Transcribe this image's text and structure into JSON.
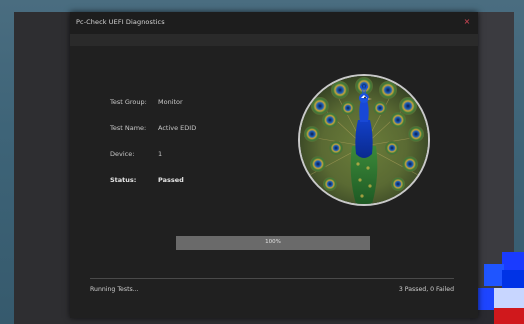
{
  "window": {
    "title": "Pc-Check UEFI Diagnostics",
    "close_glyph": "×"
  },
  "test_info": [
    {
      "label": "Test Group:",
      "value": "Monitor",
      "bold": false
    },
    {
      "label": "Test Name:",
      "value": "Active EDID",
      "bold": false
    },
    {
      "label": "Device:",
      "value": "1",
      "bold": false
    },
    {
      "label": "Status:",
      "value": "Passed",
      "bold": true
    }
  ],
  "image": {
    "icon": "peacock-image"
  },
  "progress": {
    "value_percent": 100,
    "label": "100%"
  },
  "footer": {
    "status_text": "Running Tests...",
    "summary": "3 Passed, 0 Failed"
  },
  "colors": {
    "accent_close": "#e04a5a",
    "window_bg": "#202020",
    "desktop_bg": "#3a6176"
  }
}
